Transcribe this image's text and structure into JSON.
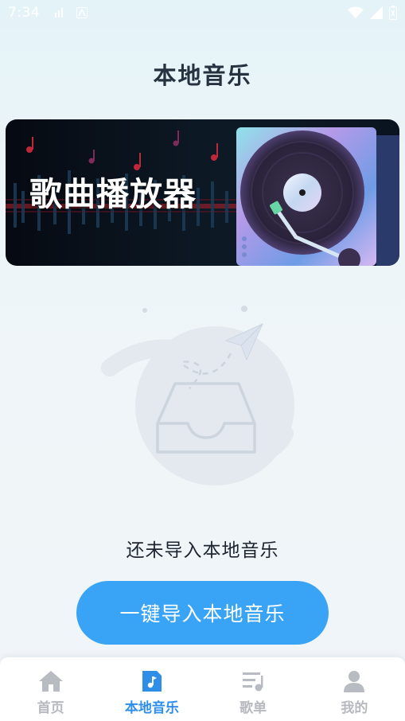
{
  "status_bar": {
    "time": "7:34"
  },
  "header": {
    "title": "本地音乐"
  },
  "banner": {
    "title": "歌曲播放器"
  },
  "empty_state": {
    "message": "还未导入本地音乐"
  },
  "import_button": {
    "label": "一键导入本地音乐"
  },
  "tab_bar": {
    "active": 1,
    "items": [
      {
        "label": "首页",
        "icon": "home-icon"
      },
      {
        "label": "本地音乐",
        "icon": "music-file-icon"
      },
      {
        "label": "歌单",
        "icon": "playlist-icon"
      },
      {
        "label": "我的",
        "icon": "user-icon"
      }
    ]
  },
  "colors": {
    "accent": "#39a3f5",
    "active_tab": "#2f8fe8",
    "inactive_tab": "#b6b9bf"
  }
}
